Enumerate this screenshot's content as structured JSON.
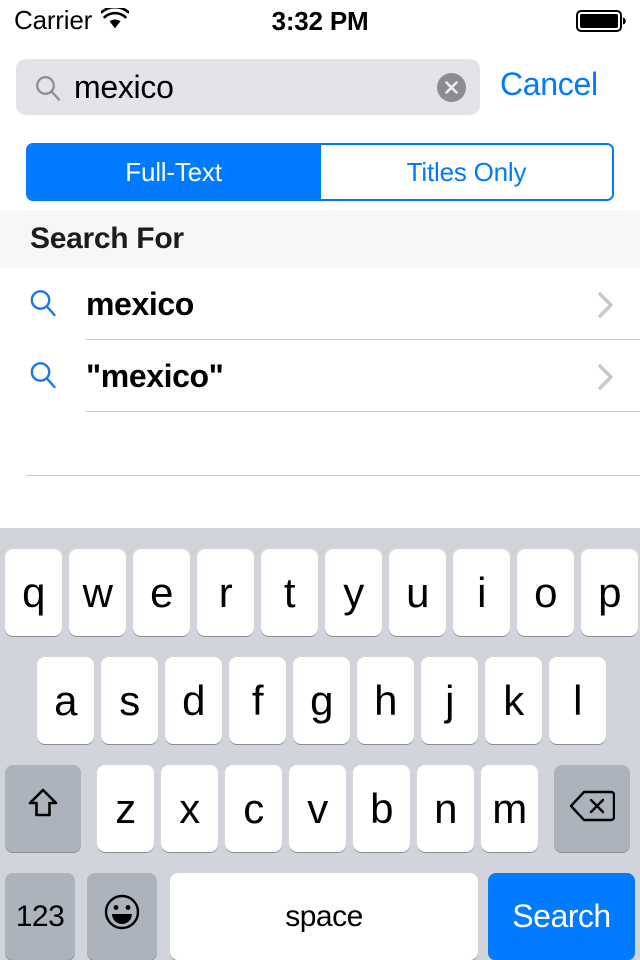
{
  "status_bar": {
    "carrier": "Carrier",
    "wifi_icon": "wifi-icon",
    "time": "3:32 PM",
    "battery_icon": "battery-full-icon"
  },
  "search_bar": {
    "magnifier_icon": "search-icon",
    "value": "mexico",
    "placeholder": "Search",
    "clear_icon": "clear-circle-icon",
    "cancel_label": "Cancel",
    "cancel_color": "#007aff"
  },
  "segmented_control": {
    "options": [
      {
        "label": "Full-Text",
        "selected": true
      },
      {
        "label": "Titles Only",
        "selected": false
      }
    ],
    "tint_color": "#007aff"
  },
  "section": {
    "header": "Search For"
  },
  "results": [
    {
      "icon": "search-icon",
      "label": "mexico",
      "accessory": "chevron-right-icon"
    },
    {
      "icon": "search-icon",
      "label": "\"mexico\"",
      "accessory": "chevron-right-icon"
    }
  ],
  "keyboard": {
    "row1": [
      "q",
      "w",
      "e",
      "r",
      "t",
      "y",
      "u",
      "i",
      "o",
      "p"
    ],
    "row2": [
      "a",
      "s",
      "d",
      "f",
      "g",
      "h",
      "j",
      "k",
      "l"
    ],
    "row3": [
      "z",
      "x",
      "c",
      "v",
      "b",
      "n",
      "m"
    ],
    "shift_icon": "shift-arrow-icon",
    "backspace_icon": "backspace-delete-icon",
    "numeric_label": "123",
    "emoji_icon": "smiley-face-icon",
    "space_label": "space",
    "return_label": "Search",
    "return_color": "#007aff"
  }
}
